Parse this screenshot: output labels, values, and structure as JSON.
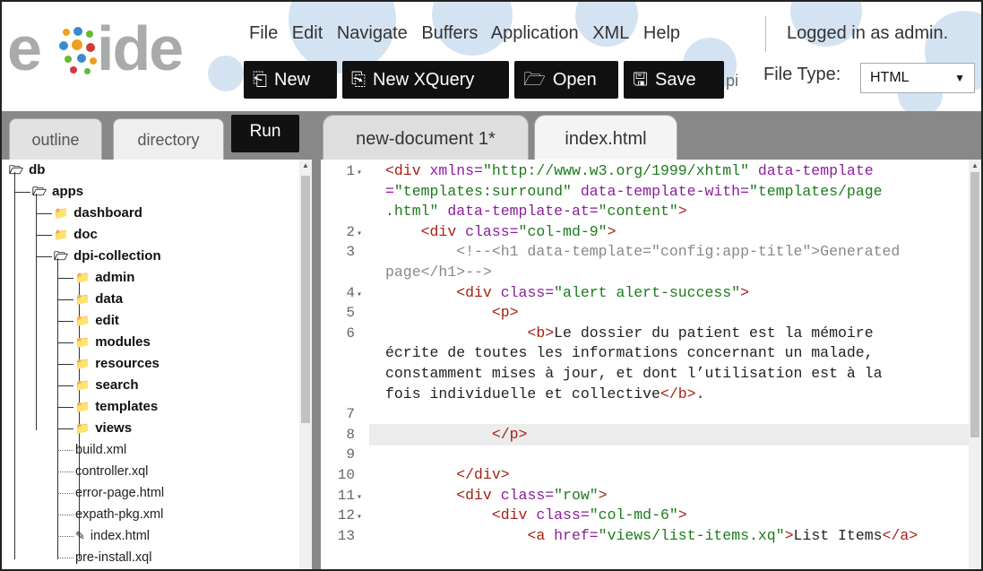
{
  "header": {
    "logo_text": "eXide",
    "menu": [
      "File",
      "Edit",
      "Navigate",
      "Buffers",
      "Application",
      "XML",
      "Help"
    ],
    "login_status": "Logged in as admin.",
    "toolbar": [
      {
        "label": "New",
        "icon": "new-file-icon"
      },
      {
        "label": "New XQuery",
        "icon": "new-xquery-icon"
      },
      {
        "label": "Open",
        "icon": "folder-open-icon"
      },
      {
        "label": "Save",
        "icon": "floppy-disk-icon"
      }
    ],
    "ghost_text": "pi",
    "file_type_label": "File Type:",
    "file_type_value": "HTML"
  },
  "left_panel": {
    "tabs": [
      "outline",
      "directory"
    ],
    "run_label": "Run",
    "tree": [
      {
        "label": "db",
        "type": "folder-open",
        "depth": 0
      },
      {
        "label": "apps",
        "type": "folder-open",
        "depth": 1
      },
      {
        "label": "dashboard",
        "type": "folder",
        "depth": 2
      },
      {
        "label": "doc",
        "type": "folder",
        "depth": 2
      },
      {
        "label": "dpi-collection",
        "type": "folder-open",
        "depth": 2
      },
      {
        "label": "admin",
        "type": "folder",
        "depth": 3
      },
      {
        "label": "data",
        "type": "folder",
        "depth": 3
      },
      {
        "label": "edit",
        "type": "folder",
        "depth": 3
      },
      {
        "label": "modules",
        "type": "folder",
        "depth": 3
      },
      {
        "label": "resources",
        "type": "folder",
        "depth": 3
      },
      {
        "label": "search",
        "type": "folder",
        "depth": 3
      },
      {
        "label": "templates",
        "type": "folder",
        "depth": 3
      },
      {
        "label": "views",
        "type": "folder",
        "depth": 3
      },
      {
        "label": "build.xml",
        "type": "file",
        "depth": 3
      },
      {
        "label": "controller.xql",
        "type": "file",
        "depth": 3
      },
      {
        "label": "error-page.html",
        "type": "file",
        "depth": 3
      },
      {
        "label": "expath-pkg.xml",
        "type": "file",
        "depth": 3
      },
      {
        "label": "index.html",
        "type": "file-edit",
        "depth": 3
      },
      {
        "label": "pre-install.xql",
        "type": "file",
        "depth": 3
      }
    ]
  },
  "editor": {
    "tabs": [
      "new-document 1*",
      "index.html"
    ],
    "lines": [
      {
        "n": "1",
        "fold": true,
        "parts": [
          [
            "t",
            "<div "
          ],
          [
            "a",
            "xmlns="
          ],
          [
            "s",
            "\"http://www.w3.org/1999/xhtml\""
          ],
          [
            "a",
            " data-template"
          ]
        ]
      },
      {
        "n": "",
        "parts": [
          [
            "a",
            "="
          ],
          [
            "s",
            "\"templates:surround\""
          ],
          [
            "a",
            " data-template-with="
          ],
          [
            "s",
            "\"templates/page"
          ]
        ]
      },
      {
        "n": "",
        "parts": [
          [
            "s",
            ".html\""
          ],
          [
            "a",
            " data-template-at="
          ],
          [
            "s",
            "\"content\""
          ],
          [
            "t",
            ">"
          ]
        ]
      },
      {
        "n": "2",
        "fold": true,
        "parts": [
          [
            "txt",
            "    "
          ],
          [
            "t",
            "<div "
          ],
          [
            "a",
            "class="
          ],
          [
            "s",
            "\"col-md-9\""
          ],
          [
            "t",
            ">"
          ]
        ]
      },
      {
        "n": "3",
        "parts": [
          [
            "txt",
            "        "
          ],
          [
            "c",
            "<!--<h1 data-template=\"config:app-title\">Generated"
          ]
        ]
      },
      {
        "n": "",
        "parts": [
          [
            "c",
            "page</h1>-->"
          ]
        ]
      },
      {
        "n": "4",
        "fold": true,
        "parts": [
          [
            "txt",
            "        "
          ],
          [
            "t",
            "<div "
          ],
          [
            "a",
            "class="
          ],
          [
            "s",
            "\"alert alert-success\""
          ],
          [
            "t",
            ">"
          ]
        ]
      },
      {
        "n": "5",
        "parts": [
          [
            "txt",
            "            "
          ],
          [
            "t",
            "<p>"
          ]
        ]
      },
      {
        "n": "6",
        "parts": [
          [
            "txt",
            "                "
          ],
          [
            "t",
            "<b>"
          ],
          [
            "txt",
            "Le dossier du patient est la mémoire"
          ]
        ]
      },
      {
        "n": "",
        "parts": [
          [
            "txt",
            "écrite de toutes les informations concernant un malade,"
          ]
        ]
      },
      {
        "n": "",
        "parts": [
          [
            "txt",
            "constamment mises à jour, et dont l’utilisation est à la"
          ]
        ]
      },
      {
        "n": "",
        "parts": [
          [
            "txt",
            "fois individuelle et collective"
          ],
          [
            "t",
            "</b>"
          ],
          [
            "txt",
            "."
          ]
        ]
      },
      {
        "n": "7",
        "parts": []
      },
      {
        "n": "8",
        "parts": [
          [
            "txt",
            "            "
          ],
          [
            "t",
            "</p>"
          ]
        ]
      },
      {
        "n": "9",
        "parts": []
      },
      {
        "n": "10",
        "parts": [
          [
            "txt",
            "        "
          ],
          [
            "t",
            "</div>"
          ]
        ]
      },
      {
        "n": "11",
        "fold": true,
        "parts": [
          [
            "txt",
            "        "
          ],
          [
            "t",
            "<div "
          ],
          [
            "a",
            "class="
          ],
          [
            "s",
            "\"row\""
          ],
          [
            "t",
            ">"
          ]
        ]
      },
      {
        "n": "12",
        "fold": true,
        "parts": [
          [
            "txt",
            "            "
          ],
          [
            "t",
            "<div "
          ],
          [
            "a",
            "class="
          ],
          [
            "s",
            "\"col-md-6\""
          ],
          [
            "t",
            ">"
          ]
        ]
      },
      {
        "n": "13",
        "parts": [
          [
            "txt",
            "                "
          ],
          [
            "t",
            "<a "
          ],
          [
            "a",
            "href="
          ],
          [
            "s",
            "\"views/list-items.xq\""
          ],
          [
            "t",
            ">"
          ],
          [
            "txt",
            "List Items"
          ],
          [
            "t",
            "</a>"
          ]
        ]
      }
    ]
  }
}
